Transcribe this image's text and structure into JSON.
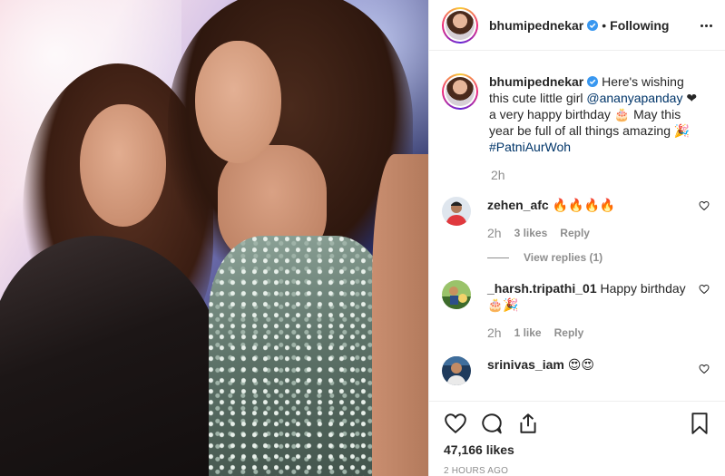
{
  "post": {
    "username": "bhumipednekar",
    "follow_status": "Following",
    "separator": "•",
    "caption": {
      "username": "bhumipednekar",
      "text_before": " Here's wishing this cute little girl ",
      "mention": "@ananyapanday",
      "text_after": " ❤ a very happy birthday 🎂 May this year be full of all things amazing 🎉 ",
      "hashtag": "#PatniAurWoh",
      "time": "2h"
    },
    "comments": [
      {
        "username": "zehen_afc",
        "text": " 🔥🔥🔥🔥",
        "time": "2h",
        "likes": "3 likes",
        "reply": "Reply",
        "view_replies": "View replies (1)"
      },
      {
        "username": "_harsh.tripathi_01",
        "text": " Happy birthday 🎂🎉",
        "time": "2h",
        "likes": "1 like",
        "reply": "Reply"
      },
      {
        "username": "srinivas_iam",
        "text": " 😍😍"
      }
    ],
    "likes_count": "47,166 likes",
    "timestamp": "2 HOURS AGO"
  },
  "colors": {
    "verified": "#3897f0",
    "link": "#003569",
    "muted": "#8e8e8e"
  },
  "icons": [
    "more-options-icon",
    "verified-icon",
    "heart-icon",
    "comment-icon",
    "share-icon",
    "bookmark-icon"
  ]
}
